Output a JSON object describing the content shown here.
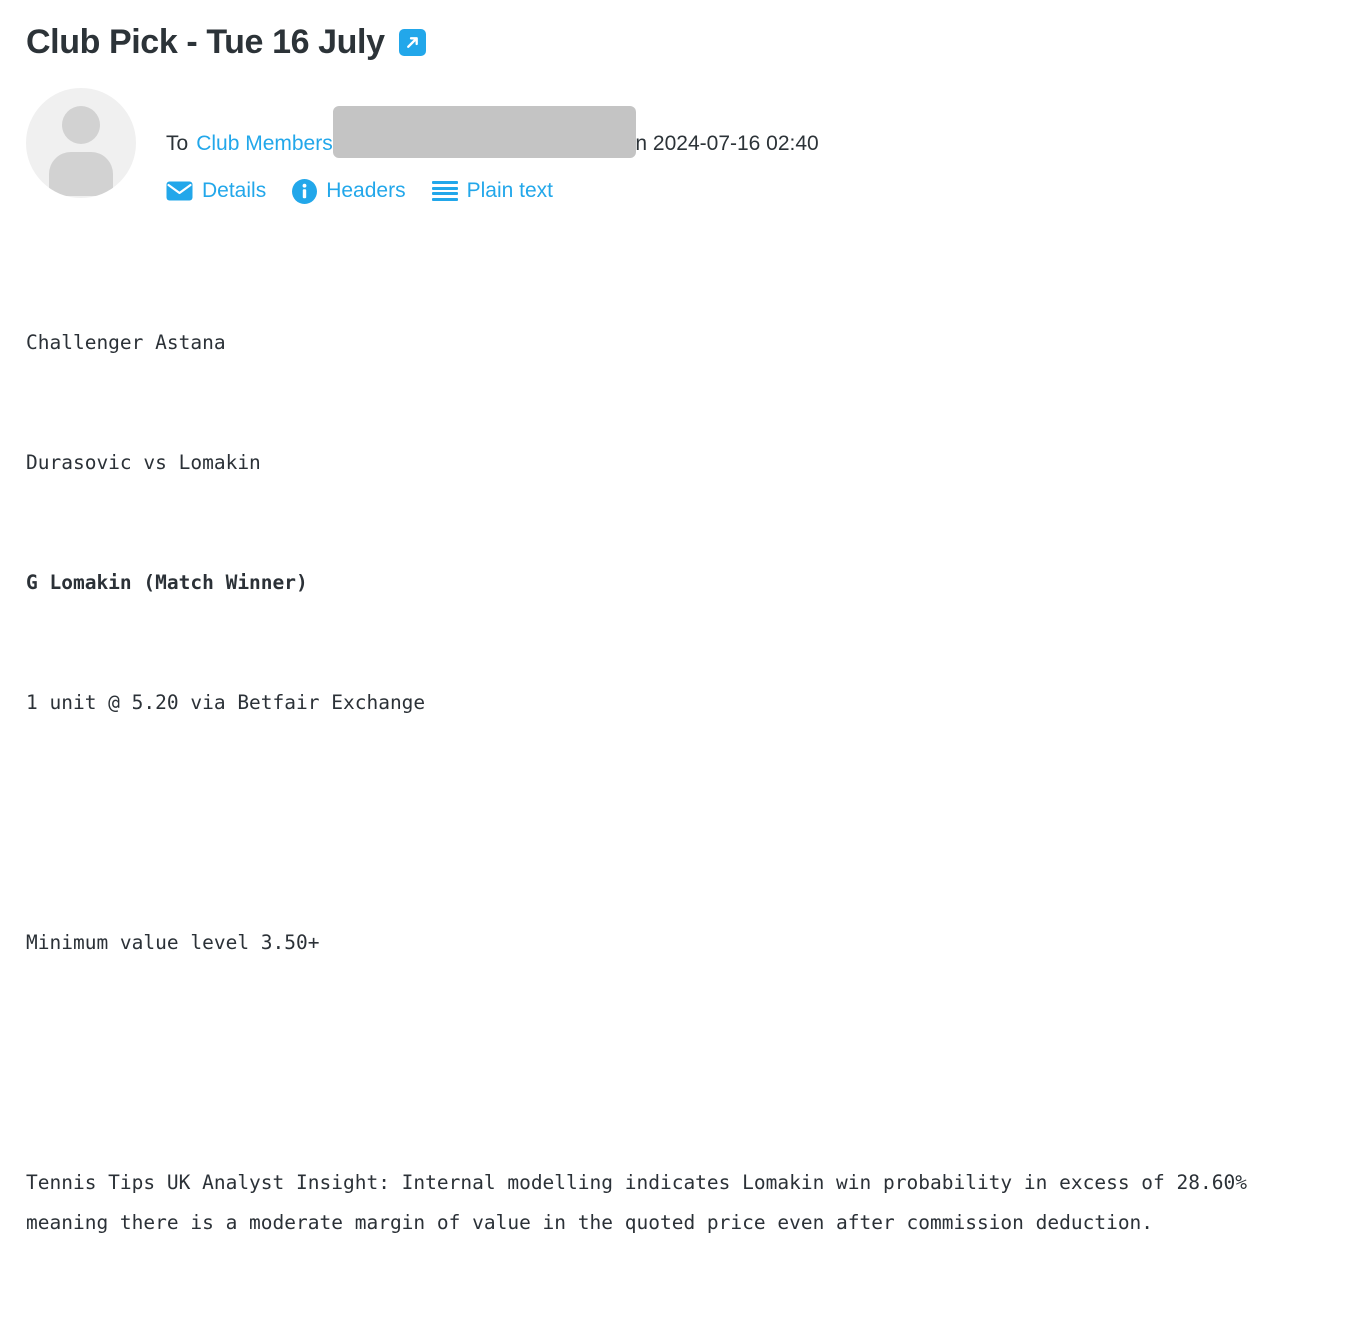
{
  "header": {
    "title": "Club Pick - Tue 16 July",
    "external_link_icon": "external-link-icon",
    "accent_color": "#22a7ea",
    "title_color": "#2c3338"
  },
  "meta": {
    "avatar_icon": "user-avatar-placeholder",
    "to_label": "To",
    "recipient": "Club Members",
    "redaction_present": true,
    "redaction_color": "#c4c4c4",
    "sent_on": "on 2024-07-16 02:40",
    "actions": [
      {
        "icon": "envelope-icon",
        "label": "Details"
      },
      {
        "icon": "info-circle-icon",
        "label": "Headers"
      },
      {
        "icon": "list-lines-icon",
        "label": "Plain text"
      }
    ]
  },
  "body": {
    "lines": [
      {
        "text": "Challenger Astana",
        "bold": false
      },
      {
        "text": "Durasovic vs Lomakin",
        "bold": false
      },
      {
        "text": "G Lomakin (Match Winner)",
        "bold": true
      },
      {
        "text": "1 unit @ 5.20 via Betfair Exchange",
        "bold": false
      },
      {
        "text": "",
        "bold": false
      },
      {
        "text": "Minimum value level 3.50+",
        "bold": false
      },
      {
        "text": "",
        "bold": false
      },
      {
        "text": "Tennis Tips UK Analyst Insight: Internal modelling indicates Lomakin win probability in excess of 28.60% meaning there is a moderate margin of value in the quoted price even after commission deduction.",
        "bold": false
      }
    ]
  }
}
